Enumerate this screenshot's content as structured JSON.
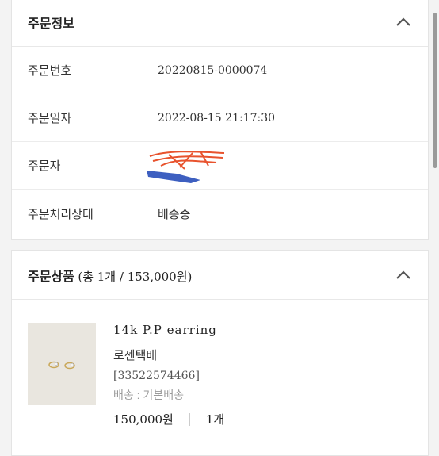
{
  "order_info": {
    "title": "주문정보",
    "rows": [
      {
        "label": "주문번호",
        "value": "20220815-0000074"
      },
      {
        "label": "주문일자",
        "value": "2022-08-15 21:17:30"
      },
      {
        "label": "주문자",
        "value": ""
      },
      {
        "label": "주문처리상태",
        "value": "배송중"
      }
    ]
  },
  "order_products": {
    "title": "주문상품",
    "subtitle": "(총 1개 / 153,000원)",
    "items": [
      {
        "name": "14k P.P earring",
        "brand": "로젠택배",
        "code": "[33522574466]",
        "shipping": "배송 : 기본배송",
        "price": "150,000원",
        "quantity": "1개"
      }
    ]
  }
}
